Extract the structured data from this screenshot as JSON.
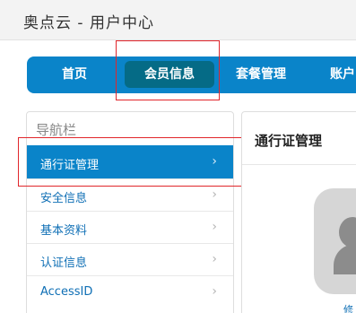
{
  "header": {
    "title": "奥点云 - 用户中心"
  },
  "nav": {
    "home": "首页",
    "member_info": "会员信息",
    "package": "套餐管理",
    "account": "账户"
  },
  "sidebar": {
    "title": "导航栏",
    "items": [
      {
        "label": "通行证管理",
        "chevron": "›"
      },
      {
        "label": "安全信息",
        "chevron": "›"
      },
      {
        "label": "基本资料",
        "chevron": "›"
      },
      {
        "label": "认证信息",
        "chevron": "›"
      },
      {
        "label": "AccessID",
        "chevron": "›"
      }
    ]
  },
  "content": {
    "title": "通行证管理",
    "edit_link": "修"
  },
  "colors": {
    "accent": "#0a84c9",
    "nav_active": "#056b86",
    "highlight_box": "#e1262b",
    "link": "#0f6fb5"
  },
  "icons": {
    "chevron": "chevron-right-icon",
    "avatar": "user-avatar-icon"
  }
}
